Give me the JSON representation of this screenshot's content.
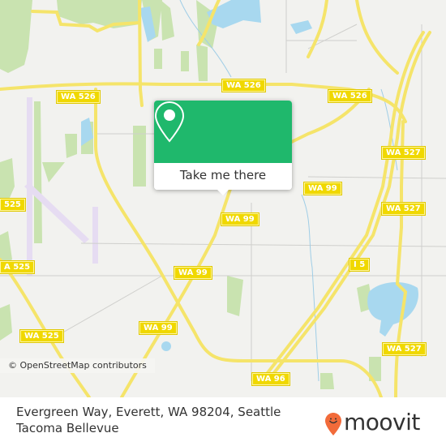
{
  "map": {
    "road_labels": [
      {
        "id": "wa526-left",
        "text": "WA 526"
      },
      {
        "id": "wa526-center",
        "text": "WA 526"
      },
      {
        "id": "wa526-right",
        "text": "WA 526"
      },
      {
        "id": "wa527-top",
        "text": "WA 527"
      },
      {
        "id": "wa527-mid",
        "text": "WA 527"
      },
      {
        "id": "wa527-bottom",
        "text": "WA 527"
      },
      {
        "id": "wa99-right",
        "text": "WA 99"
      },
      {
        "id": "wa99-marker",
        "text": "WA 99"
      },
      {
        "id": "wa99-mid",
        "text": "WA 99"
      },
      {
        "id": "wa99-lower",
        "text": "WA 99"
      },
      {
        "id": "wa525-top",
        "text": "525"
      },
      {
        "id": "wa525-mid",
        "text": "A 525"
      },
      {
        "id": "wa525-bottom",
        "text": "WA 525"
      },
      {
        "id": "i5",
        "text": "I 5"
      },
      {
        "id": "wa96",
        "text": "WA 96"
      }
    ],
    "attribution": "© OpenStreetMap contributors",
    "colors": {
      "land": "#f2f2ef",
      "road": "#f5e46a",
      "water": "#a8d8ef",
      "park": "#c9e3b0",
      "airport": "#e6dcf2"
    }
  },
  "popup": {
    "button_label": "Take me there",
    "icon": "map-pin-icon",
    "color": "#1fb86c"
  },
  "footer": {
    "address": "Evergreen Way, Everett, WA 98204, Seattle Tacoma Bellevue",
    "brand": "moovit",
    "brand_color": "#f26b3a"
  }
}
